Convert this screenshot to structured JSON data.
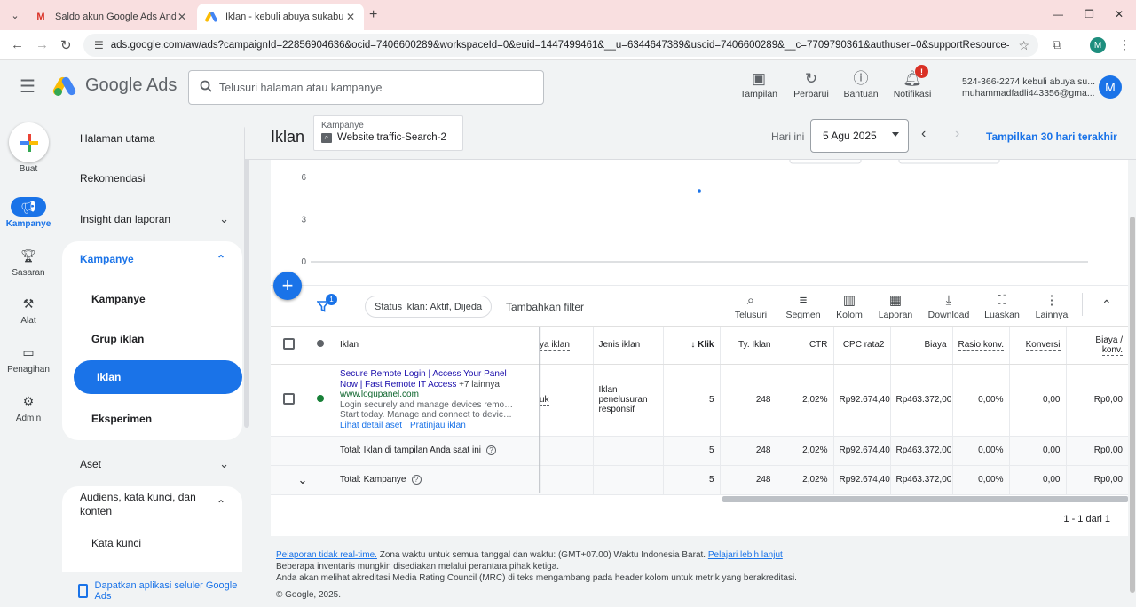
{
  "browser": {
    "tabs": [
      {
        "title": "Saldo akun Google Ads Anda h",
        "favicon": "M"
      },
      {
        "title": "Iklan - kebuli abuya sukabumi -",
        "favicon": "ads"
      }
    ],
    "url": "ads.google.com/aw/ads?campaignId=22856904636&ocid=7406600289&workspaceId=0&euid=1447499461&__u=6344647389&uscid=7406600289&__c=7709790361&authuser=0&supportResource=g...",
    "profile_initial": "M"
  },
  "header": {
    "logo_text": "Google Ads",
    "search_placeholder": "Telusuri halaman atau kampanye",
    "actions": [
      {
        "label": "Tampilan",
        "icon": "appearance-icon"
      },
      {
        "label": "Perbarui",
        "icon": "refresh-icon"
      },
      {
        "label": "Bantuan",
        "icon": "help-icon"
      },
      {
        "label": "Notifikasi",
        "icon": "bell-icon",
        "badge": "!"
      }
    ],
    "account_line1": "524-366-2274 kebuli abuya su...",
    "account_line2": "muhammadfadli443356@gma...",
    "avatar_initial": "M"
  },
  "rail": {
    "create_label": "Buat",
    "items": [
      {
        "label": "Kampanye",
        "icon": "megaphone-icon",
        "active": true
      },
      {
        "label": "Sasaran",
        "icon": "trophy-icon",
        "active": false
      },
      {
        "label": "Alat",
        "icon": "tools-icon",
        "active": false
      },
      {
        "label": "Penagihan",
        "icon": "credit-card-icon",
        "active": false
      },
      {
        "label": "Admin",
        "icon": "gear-icon",
        "active": false
      }
    ]
  },
  "sidenav": {
    "home": "Halaman utama",
    "recommendations": "Rekomendasi",
    "insights": "Insight dan laporan",
    "campaigns_section": "Kampanye",
    "campaign_items": [
      "Kampanye",
      "Grup iklan",
      "Iklan",
      "Eksperimen"
    ],
    "active_item": "Iklan",
    "assets": "Aset",
    "audiences": "Audiens, kata kunci, dan konten",
    "keywords": "Kata kunci",
    "get_app": "Dapatkan aplikasi seluler Google Ads"
  },
  "page": {
    "title": "Iklan",
    "campaign_selector_label": "Kampanye",
    "campaign_name": "Website traffic-Search-2",
    "today_label": "Hari ini",
    "date": "5 Agu 2025",
    "show_30_days": "Tampilkan 30 hari terakhir"
  },
  "chart_data": {
    "type": "line",
    "y_ticks": [
      "6",
      "3",
      "0"
    ],
    "ylim": [
      0,
      6
    ]
  },
  "toolbar": {
    "filter_count": "1",
    "status_chip": "Status iklan: Aktif, Dijeda",
    "add_filter": "Tambahkan filter",
    "tools": [
      {
        "label": "Telusuri",
        "icon": "search-icon"
      },
      {
        "label": "Segmen",
        "icon": "segment-icon"
      },
      {
        "label": "Kolom",
        "icon": "columns-icon"
      },
      {
        "label": "Laporan",
        "icon": "report-icon"
      },
      {
        "label": "Download",
        "icon": "download-icon"
      },
      {
        "label": "Luaskan",
        "icon": "expand-icon"
      },
      {
        "label": "Lainnya",
        "icon": "more-vert-icon"
      }
    ]
  },
  "table": {
    "columns": {
      "ad": "Iklan",
      "status_partial": "ya iklan",
      "ad_type": "Jenis iklan",
      "clicks": "Klik",
      "impressions": "Ty. Iklan",
      "ctr": "CTR",
      "avg_cpc": "CPC rata2",
      "cost": "Biaya",
      "conv_rate": "Rasio konv.",
      "conversions": "Konversi",
      "cost_per_conv_1": "Biaya /",
      "cost_per_conv_2": "konv."
    },
    "ad_row": {
      "headline1": "Secure Remote Login | Access Your Panel",
      "headline2": "Now | Fast Remote IT Access",
      "more": "+7 lainnya",
      "display_url": "www.logupanel.com",
      "desc1": "Login securely and manage devices remotely.",
      "desc2": "Start today. Manage and connect to devices...",
      "link_details": "Lihat detail aset",
      "link_sep": "·",
      "link_preview": "Pratinjau iklan",
      "status_partial": "uk",
      "ad_type": "Iklan penelusuran responsif",
      "clicks": "5",
      "impressions": "248",
      "ctr": "2,02%",
      "avg_cpc": "Rp92.674,40",
      "cost": "Rp463.372,00",
      "conv_rate": "0,00%",
      "conversions": "0,00",
      "cost_per_conv": "Rp0,00",
      "status_color": "#188038"
    },
    "totals": [
      {
        "label": "Total: Iklan di tampilan Anda saat ini",
        "clicks": "5",
        "impressions": "248",
        "ctr": "2,02%",
        "avg_cpc": "Rp92.674,40",
        "cost": "Rp463.372,00",
        "conv_rate": "0,00%",
        "conversions": "0,00",
        "cost_per_conv": "Rp0,00"
      },
      {
        "label": "Total: Kampanye",
        "clicks": "5",
        "impressions": "248",
        "ctr": "2,02%",
        "avg_cpc": "Rp92.674,40",
        "cost": "Rp463.372,00",
        "conv_rate": "0,00%",
        "conversions": "0,00",
        "cost_per_conv": "Rp0,00"
      }
    ],
    "pagination": "1 - 1 dari 1"
  },
  "footer": {
    "link1": "Pelaporan tidak real-time.",
    "text1": " Zona waktu untuk semua tanggal dan waktu: (GMT+07.00) Waktu Indonesia Barat. ",
    "link2": "Pelajari lebih lanjut",
    "line2": "Beberapa inventaris mungkin disediakan melalui perantara pihak ketiga.",
    "line3": "Anda akan melihat akreditasi Media Rating Council (MRC) di teks mengambang pada header kolom untuk metrik yang berakreditasi.",
    "copyright": "© Google, 2025."
  },
  "colors": {
    "primary": "#1a73e8",
    "tab_bar": "#f9dfe0",
    "status_enabled": "#188038",
    "badge": "#d93025"
  }
}
